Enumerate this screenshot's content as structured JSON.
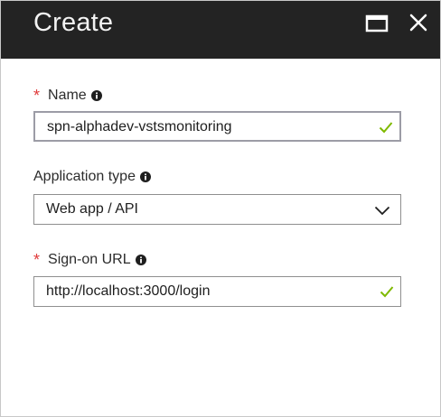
{
  "window": {
    "title": "Create"
  },
  "form": {
    "name": {
      "label": "Name",
      "required_mark": "*",
      "value": "spn-alphadev-vstsmonitoring"
    },
    "application_type": {
      "label": "Application type",
      "selected": "Web app / API"
    },
    "sign_on_url": {
      "label": "Sign-on URL",
      "required_mark": "*",
      "value": "http://localhost:3000/login"
    }
  },
  "colors": {
    "header_bg": "#232323",
    "required": "#e03a3a",
    "valid_check": "#7fb900"
  }
}
